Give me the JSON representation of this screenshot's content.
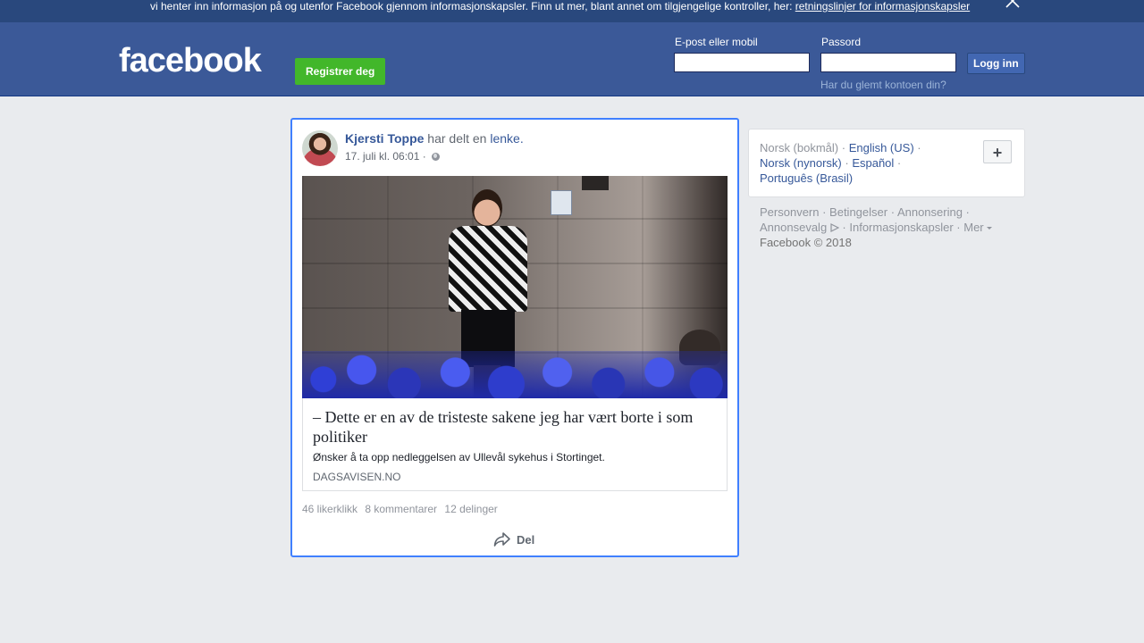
{
  "cookie_banner": {
    "text": "vi henter inn informasjon på og utenfor Facebook gjennom informasjonskapsler. Finn ut mer, blant annet om tilgjengelige kontroller, her: ",
    "link": "retningslinjer for informasjonskapsler"
  },
  "header": {
    "logo": "facebook",
    "register_label": "Registrer deg",
    "email_label": "E-post eller mobil",
    "password_label": "Passord",
    "login_label": "Logg inn",
    "forgot_label": "Har du glemt kontoen din?"
  },
  "post": {
    "author": "Kjersti Toppe",
    "action": " har delt en ",
    "link_word": "lenke.",
    "timestamp": "17. juli kl. 06:01 ·",
    "link_title": "– Dette er en av de tristeste sakene jeg har vært borte i som politiker",
    "link_description": "Ønsker å ta opp nedleggelsen av Ullevål sykehus i Stortinget.",
    "link_domain": "DAGSAVISEN.NO",
    "likes": "46 likerklikk",
    "comments": "8 kommentarer",
    "shares": "12 delinger",
    "share_label": "Del"
  },
  "sidebar": {
    "languages": {
      "current": "Norsk (bokmål)",
      "items": [
        "English (US)",
        "Norsk (nynorsk)",
        "Español",
        "Português (Brasil)"
      ]
    },
    "add_label": "+",
    "footer": {
      "links": [
        "Personvern",
        "Betingelser",
        "Annonsering",
        "Annonsevalg",
        "Informasjonskapsler",
        "Mer"
      ],
      "copyright": "Facebook © 2018"
    }
  },
  "colors": {
    "header_bg": "#3b5998",
    "banner_bg": "#29487d",
    "register_green": "#42b72a",
    "link_blue": "#365899",
    "focus_border": "#4080ff"
  }
}
